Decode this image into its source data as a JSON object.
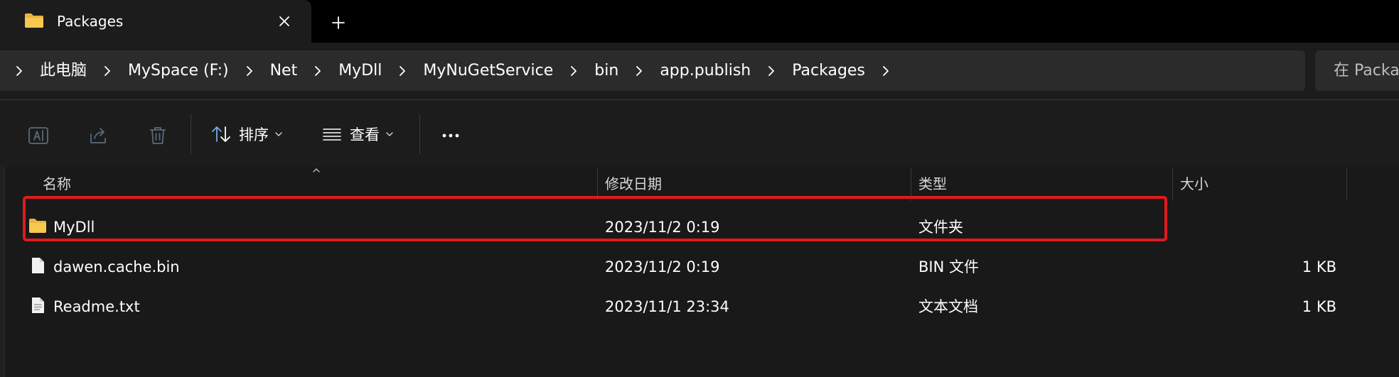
{
  "tab": {
    "title": "Packages",
    "folder_icon": "folder-icon",
    "close_icon": "close-icon",
    "new_tab_icon": "plus-icon"
  },
  "address": {
    "crumbs": [
      "此电脑",
      "MySpace (F:)",
      "Net",
      "MyDll",
      "MyNuGetService",
      "bin",
      "app.publish",
      "Packages"
    ],
    "search_placeholder": "在 Packages 中搜索"
  },
  "commands": {
    "rename_icon": "rename-icon",
    "share_icon": "share-icon",
    "delete_icon": "trash-icon",
    "sort_label": "排序",
    "view_label": "查看",
    "more_icon": "more-icon"
  },
  "columns": {
    "name": "名称",
    "modified": "修改日期",
    "type": "类型",
    "size": "大小"
  },
  "files": [
    {
      "name": "MyDll",
      "modified": "2023/11/2 0:19",
      "type": "文件夹",
      "size": "",
      "icon": "folder-icon"
    },
    {
      "name": "dawen.cache.bin",
      "modified": "2023/11/2 0:19",
      "type": "BIN 文件",
      "size": "1 KB",
      "icon": "file-icon"
    },
    {
      "name": "Readme.txt",
      "modified": "2023/11/1 23:34",
      "type": "文本文档",
      "size": "1 KB",
      "icon": "text-file-icon"
    }
  ],
  "colors": {
    "highlight": "#e0191c",
    "folder": "#f3c24b",
    "background": "#191919"
  }
}
